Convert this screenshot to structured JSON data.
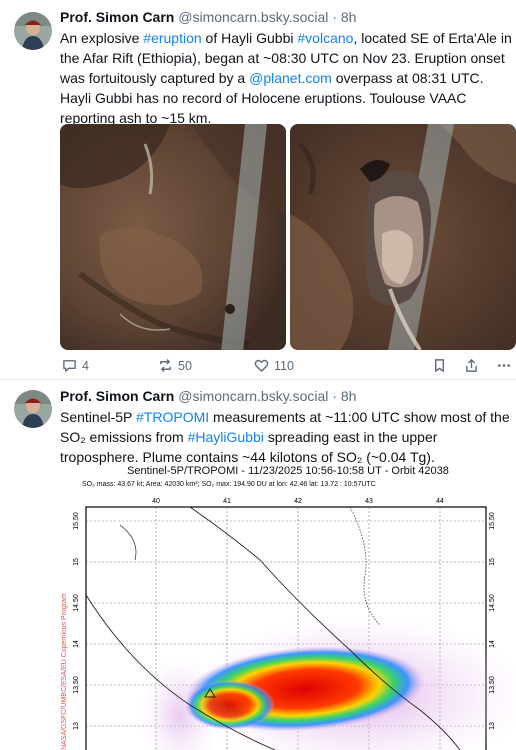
{
  "posts": [
    {
      "author": "Prof. Simon Carn",
      "handle": "@simoncarn.bsky.social",
      "time": "· 8h",
      "body": [
        {
          "t": "An explosive "
        },
        {
          "t": "#eruption",
          "link": true
        },
        {
          "t": " of Hayli Gubbi "
        },
        {
          "t": "#volcano",
          "link": true
        },
        {
          "t": ", located SE of Erta'Ale in the Afar Rift (Ethiopia), began at ~08:30 UTC on Nov 23. Eruption onset was fortuitously captured by a "
        },
        {
          "t": "@planet.com",
          "link": true
        },
        {
          "t": " overpass at 08:31 UTC. Hayli Gubbi has no record of Holocene eruptions. Toulouse VAAC reporting ash to ~15 km."
        }
      ],
      "actions": {
        "replies": "4",
        "reposts": "50",
        "likes": "110"
      }
    },
    {
      "author": "Prof. Simon Carn",
      "handle": "@simoncarn.bsky.social",
      "time": "· 8h",
      "body": [
        {
          "t": "Sentinel-5P "
        },
        {
          "t": "#TROPOMI",
          "link": true
        },
        {
          "t": " measurements at ~11:00 UTC show most of the SO₂ emissions from "
        },
        {
          "t": "#HayliGubbi",
          "link": true
        },
        {
          "t": " spreading east in the upper troposphere. Plume contains ~44 kilotons of SO₂ (~0.04 Tg)."
        }
      ]
    }
  ],
  "chart_data": {
    "type": "heatmap",
    "title": "Sentinel-5P/TROPOMI - 11/23/2025 10:56-10:58 UT - Orbit 42038",
    "subtitle": "SO₂ mass: 43.67 kt; Area: 42030 km²; SO₂ max: 194.90 DU at lon: 42.46 lat: 13.72 : 10:57UTC",
    "x_ticks": [
      "40",
      "41",
      "42",
      "43",
      "44"
    ],
    "y_ticks_left": [
      "15.50",
      "15",
      "14.50",
      "14",
      "13.50",
      "13"
    ],
    "y_ticks_right": [
      "15.50",
      "15",
      "14.50",
      "14",
      "13.50",
      "13"
    ],
    "credit": "NASA/GSFC/UMBC/ESA/EU Copernicus Program",
    "grid": true
  },
  "colors": {
    "accent": "#1083fe",
    "muted": "#5f6b78",
    "divider": "#e6e9ec"
  }
}
